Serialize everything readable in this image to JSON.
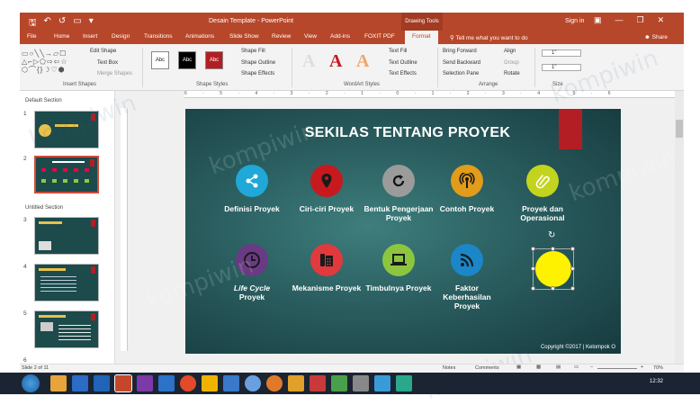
{
  "window": {
    "title": "Desain Template - PowerPoint",
    "context_tab": "Drawing Tools",
    "signin": "Sign in"
  },
  "tabs": [
    "File",
    "Home",
    "Insert",
    "Design",
    "Transitions",
    "Animations",
    "Slide Show",
    "Review",
    "View",
    "Add-ins",
    "FOXIT PDF",
    "Format"
  ],
  "active_tab": "Format",
  "tellme": "Tell me what you want to do",
  "share": "Share",
  "ribbon": {
    "insert_shapes": {
      "label": "Insert Shapes",
      "edit_shape": "Edit Shape",
      "text_box": "Text Box",
      "merge_shapes": "Merge Shapes"
    },
    "shape_styles": {
      "label": "Shape Styles",
      "style_sample": "Abc",
      "fill": "Shape Fill",
      "outline": "Shape Outline",
      "effects": "Shape Effects"
    },
    "wordart": {
      "label": "WordArt Styles",
      "letter": "A",
      "text_fill": "Text Fill",
      "text_outline": "Text Outline",
      "text_effects": "Text Effects"
    },
    "arrange": {
      "label": "Arrange",
      "bring_forward": "Bring Forward",
      "send_backward": "Send Backward",
      "selection_pane": "Selection Pane",
      "align": "Align",
      "group": "Group",
      "rotate": "Rotate"
    },
    "size": {
      "label": "Size",
      "height": "1\"",
      "width": "1\""
    }
  },
  "slides_pane": {
    "sections": [
      "Default Section",
      "Untitled Section"
    ],
    "numbers": [
      "1",
      "2",
      "3",
      "4",
      "5",
      "6"
    ]
  },
  "ruler": {
    "h": "6 · 5 · 4 · 3 · 2 · 1 · 0 · 1 · 2 · 3 · 4 · 5 · 6"
  },
  "slide": {
    "title": "SEKILAS TENTANG PROYEK",
    "copyright": "Copyright ©2017  |  Kelompok O",
    "topics": [
      {
        "label": "Definisi Proyek",
        "color": "#1fa8d8",
        "icon": "share-icon"
      },
      {
        "label": "Ciri-ciri Proyek",
        "color": "#c8191e",
        "icon": "location-pin-icon"
      },
      {
        "label": "Bentuk Pengerjaan Proyek",
        "color": "#9b9b9b",
        "icon": "refresh-icon"
      },
      {
        "label": "Contoh Proyek",
        "color": "#e09c1a",
        "icon": "broadcast-icon"
      },
      {
        "label": "Proyek dan Operasional",
        "color": "#c3d41e",
        "icon": "paperclip-icon"
      },
      {
        "label_italic": "Life Cycle",
        "label": "Proyek",
        "color": "#6a3a84",
        "icon": "clock-icon"
      },
      {
        "label": "Mekanisme Proyek",
        "color": "#e2393d",
        "icon": "phone-icon"
      },
      {
        "label": "Timbulnya Proyek",
        "color": "#8cc63f",
        "icon": "laptop-icon"
      },
      {
        "label": "Faktor Keberhasilan Proyek",
        "color": "#1b86c8",
        "icon": "rss-icon"
      }
    ]
  },
  "status": {
    "slide": "Slide 2 of 11",
    "notes": "Notes",
    "comments": "Comments",
    "zoom": "70%"
  },
  "clock": "12:32",
  "watermark": "kompiwin"
}
